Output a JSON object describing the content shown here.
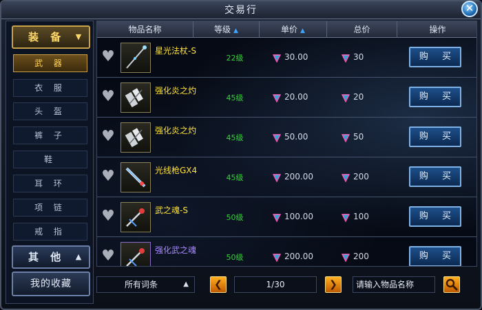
{
  "window": {
    "title": "交易行",
    "close_label": "✕"
  },
  "sidebar": {
    "equip_header": "装 备",
    "equip_items": [
      "武 器",
      "衣 服",
      "头 盔",
      "裤 子",
      "鞋",
      "耳 环",
      "项 链",
      "戒 指"
    ],
    "active_item_index": 0,
    "other_header": "其 他",
    "favorites_label": "我的收藏"
  },
  "table": {
    "headers": [
      "物品名称",
      "等级",
      "单价",
      "总价",
      "操作"
    ],
    "sortable_headers": [
      "等级",
      "单价"
    ],
    "buy_label": "购 买",
    "rows": [
      {
        "name": "星光法杖-S",
        "level": "22级",
        "price": "30.00",
        "total": "30",
        "icon": "staff-icon",
        "rarity": "gold"
      },
      {
        "name": "强化炎之灼",
        "level": "45级",
        "price": "20.00",
        "total": "20",
        "icon": "gauntlet-icon",
        "rarity": "gold"
      },
      {
        "name": "强化炎之灼",
        "level": "45级",
        "price": "50.00",
        "total": "50",
        "icon": "gauntlet-icon",
        "rarity": "gold"
      },
      {
        "name": "光线枪GX4",
        "level": "45级",
        "price": "200.00",
        "total": "200",
        "icon": "ray-gun-icon",
        "rarity": "gold"
      },
      {
        "name": "武之魂-S",
        "level": "50级",
        "price": "100.00",
        "total": "100",
        "icon": "blade-icon",
        "rarity": "gold"
      },
      {
        "name": "强化武之魂",
        "level": "50级",
        "price": "200.00",
        "total": "200",
        "icon": "blade-icon",
        "rarity": "purple"
      }
    ]
  },
  "bottom": {
    "filter_label": "所有词条",
    "page": "1/30",
    "search_placeholder": "请输入物品名称"
  },
  "colors": {
    "accent_gold": "#ffd86a",
    "level_green": "#37d43a",
    "name_gold": "#ffe23a",
    "name_purple": "#a98bff",
    "sort_arrow_blue": "#3fa6ff"
  }
}
